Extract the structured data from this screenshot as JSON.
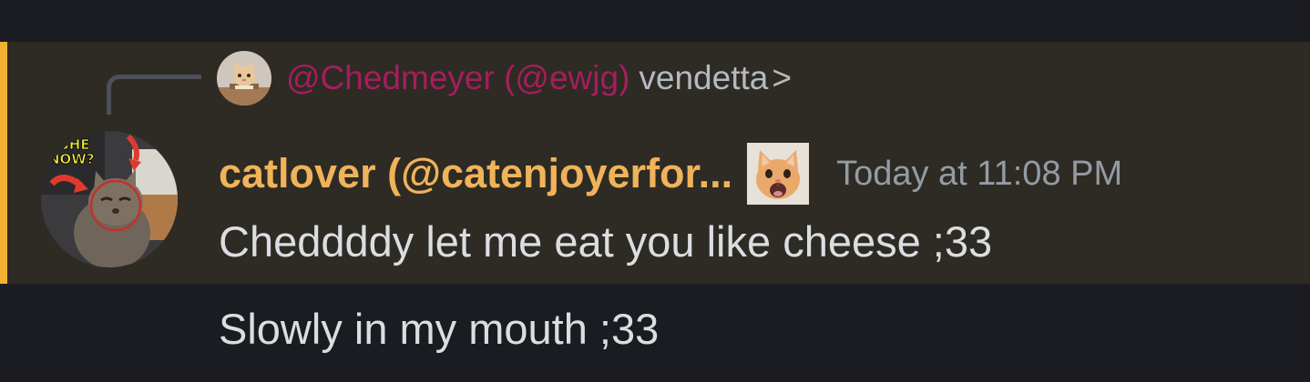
{
  "reply": {
    "author": "@Chedmeyer (@ewjg)",
    "preview": "vendetta",
    "chevron": ">",
    "avatar_icon": "kitten-avatar-icon"
  },
  "message": {
    "author": "catlover (@catenjoyerfor...",
    "timestamp": "Today at 11:08 PM",
    "avatar_icon": "cat-meme-avatar-icon",
    "sticker_icon": "screaming-kitten-icon",
    "lines": [
      "Cheddddy let me eat you like cheese ;33",
      "Slowly in my mouth ;33"
    ]
  },
  "colors": {
    "background": "#1b1c21",
    "mention_highlight": "#2e2b24",
    "mention_bar": "#f0b232",
    "reply_author": "#a61d5e",
    "author": "#f0b35a",
    "timestamp": "#949ba4",
    "text": "#dbdee1"
  }
}
